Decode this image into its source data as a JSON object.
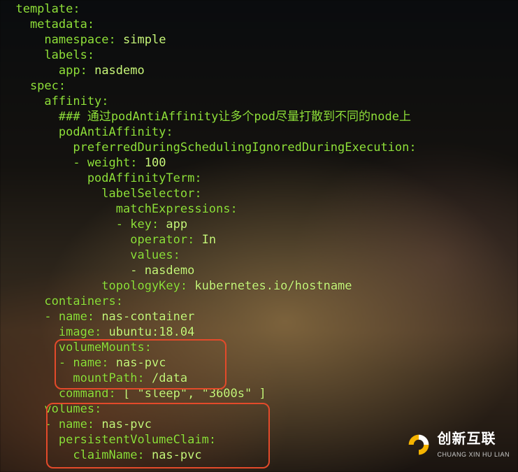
{
  "yaml": {
    "l01a": "  template",
    "l01b": ":",
    "l02a": "    metadata",
    "l02b": ":",
    "l03a": "      namespace",
    "l03b": ": ",
    "l03c": "simple",
    "l04a": "      labels",
    "l04b": ":",
    "l05a": "        app",
    "l05b": ": ",
    "l05c": "nasdemo",
    "l06a": "    spec",
    "l06b": ":",
    "l07a": "      affinity",
    "l07b": ":",
    "l08a": "        ### 通过podAntiAffinity让多个pod尽量打散到不同的node上",
    "l09a": "        podAntiAffinity",
    "l09b": ":",
    "l10a": "          preferredDuringSchedulingIgnoredDuringExecution",
    "l10b": ":",
    "l11a": "          - weight",
    "l11b": ": ",
    "l11c": "100",
    "l12a": "            podAffinityTerm",
    "l12b": ":",
    "l13a": "              labelSelector",
    "l13b": ":",
    "l14a": "                matchExpressions",
    "l14b": ":",
    "l15a": "                - key",
    "l15b": ": ",
    "l15c": "app",
    "l16a": "                  operator",
    "l16b": ": ",
    "l16c": "In",
    "l17a": "                  values",
    "l17b": ":",
    "l18a": "                  - nasdemo",
    "l19a": "              topologyKey",
    "l19b": ": ",
    "l19c": "kubernetes.io/hostname",
    "l20a": "      containers",
    "l20b": ":",
    "l21a": "      - name",
    "l21b": ": ",
    "l21c": "nas-container",
    "l22a": "        image",
    "l22b": ": ",
    "l22c": "ubuntu:18.04",
    "l23a": "        volumeMounts",
    "l23b": ":",
    "l24a": "        - name",
    "l24b": ": ",
    "l24c": "nas-pvc",
    "l25a": "          mountPath",
    "l25b": ": ",
    "l25c": "/data",
    "l26a": "        command",
    "l26b": ": ",
    "l26c": "[ \"sleep\", \"3600s\" ]",
    "l27a": "      volumes",
    "l27b": ":",
    "l28a": "      - name",
    "l28b": ": ",
    "l28c": "nas-pvc",
    "l29a": "        persistentVolumeClaim",
    "l29b": ":",
    "l30a": "          claimName",
    "l30b": ": ",
    "l30c": "nas-pvc"
  },
  "watermark": {
    "zh": "创新互联",
    "en": "CHUANG XIN HU LIAN"
  }
}
